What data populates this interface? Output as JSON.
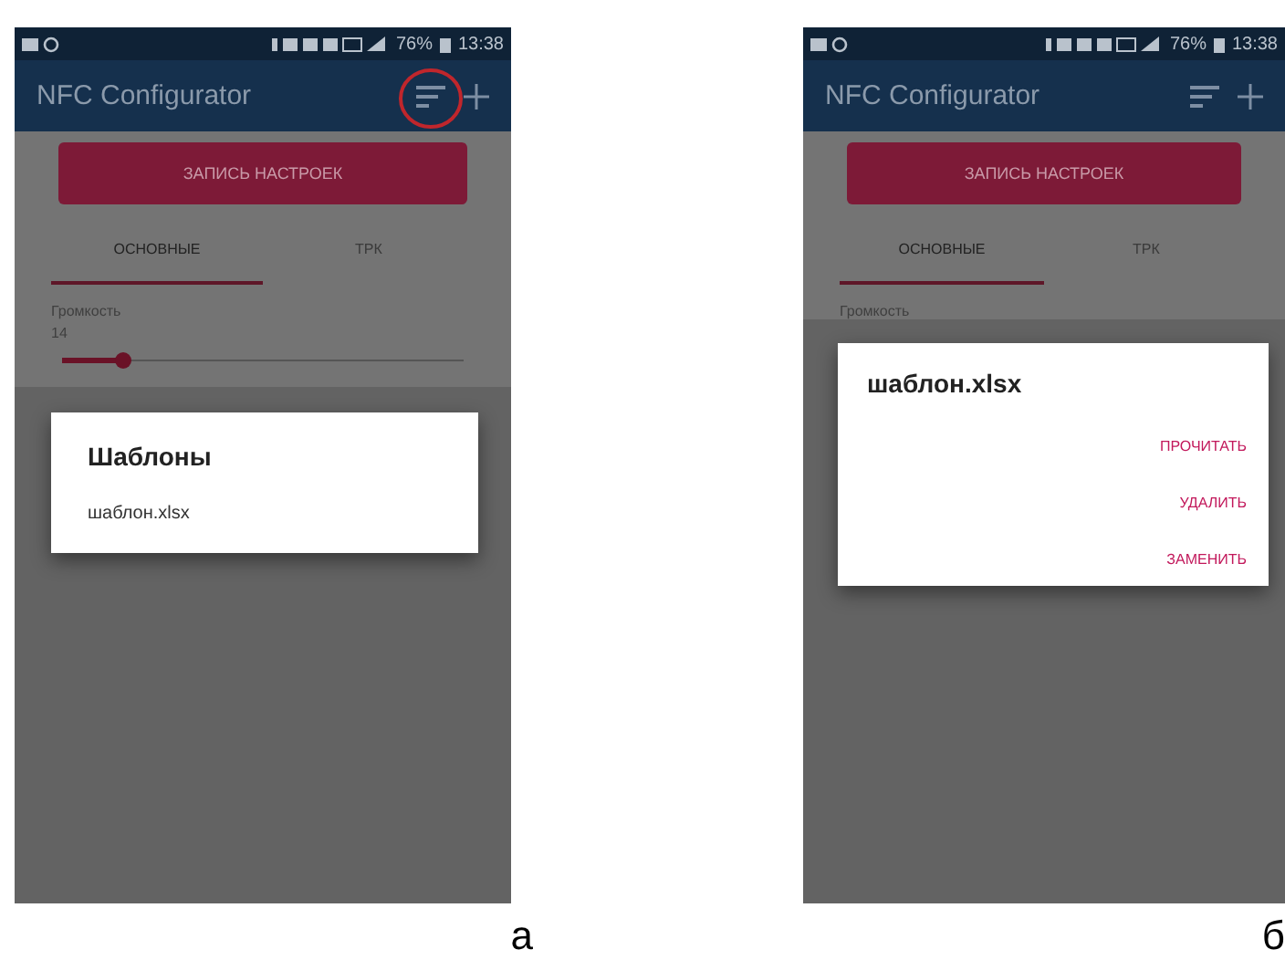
{
  "figure": {
    "panels": [
      {
        "caption": "а",
        "status_bar": {
          "battery": "76%",
          "time": "13:38"
        },
        "app_bar": {
          "title": "NFC Configurator",
          "menu_highlighted": true
        },
        "write_button": "ЗАПИСЬ НАСТРОЕК",
        "tabs": [
          {
            "label": "ОСНОВНЫЕ",
            "selected": true
          },
          {
            "label": "ТРК",
            "selected": false
          }
        ],
        "volume": {
          "label": "Громкость",
          "value": "14",
          "level": 0.15
        },
        "dialog": {
          "kind": "list",
          "title": "Шаблоны",
          "items": [
            "шаблон.xlsx"
          ]
        }
      },
      {
        "caption": "б",
        "status_bar": {
          "battery": "76%",
          "time": "13:38"
        },
        "app_bar": {
          "title": "NFC Configurator",
          "menu_highlighted": false
        },
        "write_button": "ЗАПИСЬ НАСТРОЕК",
        "tabs": [
          {
            "label": "ОСНОВНЫЕ",
            "selected": true
          },
          {
            "label": "ТРК",
            "selected": false
          }
        ],
        "volume": {
          "label": "Громкость"
        },
        "dialog": {
          "kind": "actions",
          "title": "шаблон.xlsx",
          "actions": [
            "ПРОЧИТАТЬ",
            "УДАЛИТЬ",
            "ЗАМЕНИТЬ"
          ]
        }
      }
    ]
  }
}
